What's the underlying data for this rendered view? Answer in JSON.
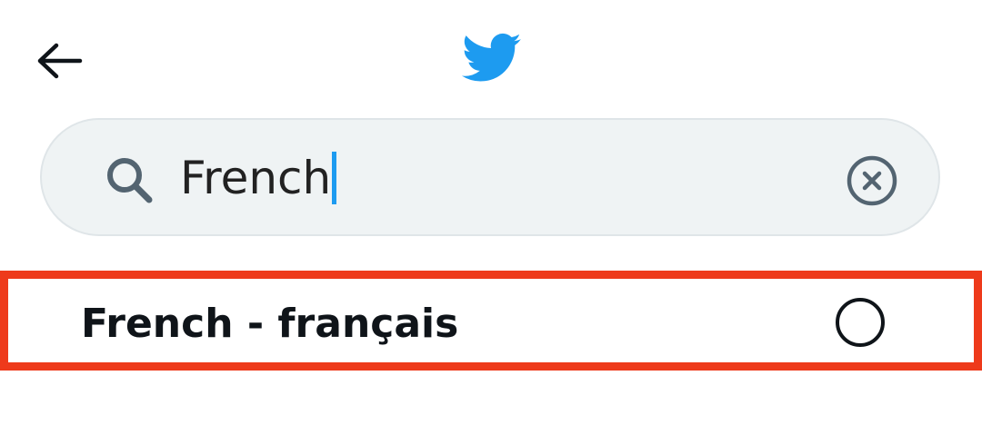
{
  "header": {
    "back_icon": "arrow-left-icon",
    "logo_icon": "twitter-bird-icon",
    "logo_color": "#1d9bf0"
  },
  "search": {
    "value": "French",
    "search_icon": "search-icon",
    "clear_icon": "clear-x-circle-icon",
    "background_color": "#eff3f4",
    "caret_color": "#1d9bf0"
  },
  "results": [
    {
      "label": "French - français",
      "selected": false
    }
  ],
  "highlight": {
    "border_color": "#ee3a1b"
  }
}
